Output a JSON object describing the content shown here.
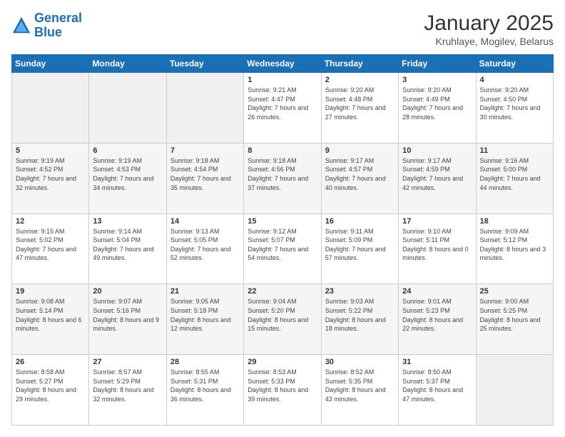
{
  "header": {
    "logo_line1": "General",
    "logo_line2": "Blue",
    "title": "January 2025",
    "subtitle": "Kruhlaye, Mogilev, Belarus"
  },
  "weekdays": [
    "Sunday",
    "Monday",
    "Tuesday",
    "Wednesday",
    "Thursday",
    "Friday",
    "Saturday"
  ],
  "weeks": [
    [
      {
        "day": "",
        "sunrise": "",
        "sunset": "",
        "daylight": ""
      },
      {
        "day": "",
        "sunrise": "",
        "sunset": "",
        "daylight": ""
      },
      {
        "day": "",
        "sunrise": "",
        "sunset": "",
        "daylight": ""
      },
      {
        "day": "1",
        "sunrise": "Sunrise: 9:21 AM",
        "sunset": "Sunset: 4:47 PM",
        "daylight": "Daylight: 7 hours and 26 minutes."
      },
      {
        "day": "2",
        "sunrise": "Sunrise: 9:20 AM",
        "sunset": "Sunset: 4:48 PM",
        "daylight": "Daylight: 7 hours and 27 minutes."
      },
      {
        "day": "3",
        "sunrise": "Sunrise: 9:20 AM",
        "sunset": "Sunset: 4:49 PM",
        "daylight": "Daylight: 7 hours and 28 minutes."
      },
      {
        "day": "4",
        "sunrise": "Sunrise: 9:20 AM",
        "sunset": "Sunset: 4:50 PM",
        "daylight": "Daylight: 7 hours and 30 minutes."
      }
    ],
    [
      {
        "day": "5",
        "sunrise": "Sunrise: 9:19 AM",
        "sunset": "Sunset: 4:52 PM",
        "daylight": "Daylight: 7 hours and 32 minutes."
      },
      {
        "day": "6",
        "sunrise": "Sunrise: 9:19 AM",
        "sunset": "Sunset: 4:53 PM",
        "daylight": "Daylight: 7 hours and 34 minutes."
      },
      {
        "day": "7",
        "sunrise": "Sunrise: 9:18 AM",
        "sunset": "Sunset: 4:54 PM",
        "daylight": "Daylight: 7 hours and 35 minutes."
      },
      {
        "day": "8",
        "sunrise": "Sunrise: 9:18 AM",
        "sunset": "Sunset: 4:56 PM",
        "daylight": "Daylight: 7 hours and 37 minutes."
      },
      {
        "day": "9",
        "sunrise": "Sunrise: 9:17 AM",
        "sunset": "Sunset: 4:57 PM",
        "daylight": "Daylight: 7 hours and 40 minutes."
      },
      {
        "day": "10",
        "sunrise": "Sunrise: 9:17 AM",
        "sunset": "Sunset: 4:59 PM",
        "daylight": "Daylight: 7 hours and 42 minutes."
      },
      {
        "day": "11",
        "sunrise": "Sunrise: 9:16 AM",
        "sunset": "Sunset: 5:00 PM",
        "daylight": "Daylight: 7 hours and 44 minutes."
      }
    ],
    [
      {
        "day": "12",
        "sunrise": "Sunrise: 9:15 AM",
        "sunset": "Sunset: 5:02 PM",
        "daylight": "Daylight: 7 hours and 47 minutes."
      },
      {
        "day": "13",
        "sunrise": "Sunrise: 9:14 AM",
        "sunset": "Sunset: 5:04 PM",
        "daylight": "Daylight: 7 hours and 49 minutes."
      },
      {
        "day": "14",
        "sunrise": "Sunrise: 9:13 AM",
        "sunset": "Sunset: 5:05 PM",
        "daylight": "Daylight: 7 hours and 52 minutes."
      },
      {
        "day": "15",
        "sunrise": "Sunrise: 9:12 AM",
        "sunset": "Sunset: 5:07 PM",
        "daylight": "Daylight: 7 hours and 54 minutes."
      },
      {
        "day": "16",
        "sunrise": "Sunrise: 9:11 AM",
        "sunset": "Sunset: 5:09 PM",
        "daylight": "Daylight: 7 hours and 57 minutes."
      },
      {
        "day": "17",
        "sunrise": "Sunrise: 9:10 AM",
        "sunset": "Sunset: 5:11 PM",
        "daylight": "Daylight: 8 hours and 0 minutes."
      },
      {
        "day": "18",
        "sunrise": "Sunrise: 9:09 AM",
        "sunset": "Sunset: 5:12 PM",
        "daylight": "Daylight: 8 hours and 3 minutes."
      }
    ],
    [
      {
        "day": "19",
        "sunrise": "Sunrise: 9:08 AM",
        "sunset": "Sunset: 5:14 PM",
        "daylight": "Daylight: 8 hours and 6 minutes."
      },
      {
        "day": "20",
        "sunrise": "Sunrise: 9:07 AM",
        "sunset": "Sunset: 5:16 PM",
        "daylight": "Daylight: 8 hours and 9 minutes."
      },
      {
        "day": "21",
        "sunrise": "Sunrise: 9:05 AM",
        "sunset": "Sunset: 5:18 PM",
        "daylight": "Daylight: 8 hours and 12 minutes."
      },
      {
        "day": "22",
        "sunrise": "Sunrise: 9:04 AM",
        "sunset": "Sunset: 5:20 PM",
        "daylight": "Daylight: 8 hours and 15 minutes."
      },
      {
        "day": "23",
        "sunrise": "Sunrise: 9:03 AM",
        "sunset": "Sunset: 5:22 PM",
        "daylight": "Daylight: 8 hours and 18 minutes."
      },
      {
        "day": "24",
        "sunrise": "Sunrise: 9:01 AM",
        "sunset": "Sunset: 5:23 PM",
        "daylight": "Daylight: 8 hours and 22 minutes."
      },
      {
        "day": "25",
        "sunrise": "Sunrise: 9:00 AM",
        "sunset": "Sunset: 5:25 PM",
        "daylight": "Daylight: 8 hours and 25 minutes."
      }
    ],
    [
      {
        "day": "26",
        "sunrise": "Sunrise: 8:58 AM",
        "sunset": "Sunset: 5:27 PM",
        "daylight": "Daylight: 8 hours and 29 minutes."
      },
      {
        "day": "27",
        "sunrise": "Sunrise: 8:57 AM",
        "sunset": "Sunset: 5:29 PM",
        "daylight": "Daylight: 8 hours and 32 minutes."
      },
      {
        "day": "28",
        "sunrise": "Sunrise: 8:55 AM",
        "sunset": "Sunset: 5:31 PM",
        "daylight": "Daylight: 8 hours and 36 minutes."
      },
      {
        "day": "29",
        "sunrise": "Sunrise: 8:53 AM",
        "sunset": "Sunset: 5:33 PM",
        "daylight": "Daylight: 8 hours and 39 minutes."
      },
      {
        "day": "30",
        "sunrise": "Sunrise: 8:52 AM",
        "sunset": "Sunset: 5:35 PM",
        "daylight": "Daylight: 8 hours and 43 minutes."
      },
      {
        "day": "31",
        "sunrise": "Sunrise: 8:50 AM",
        "sunset": "Sunset: 5:37 PM",
        "daylight": "Daylight: 8 hours and 47 minutes."
      },
      {
        "day": "",
        "sunrise": "",
        "sunset": "",
        "daylight": ""
      }
    ]
  ]
}
